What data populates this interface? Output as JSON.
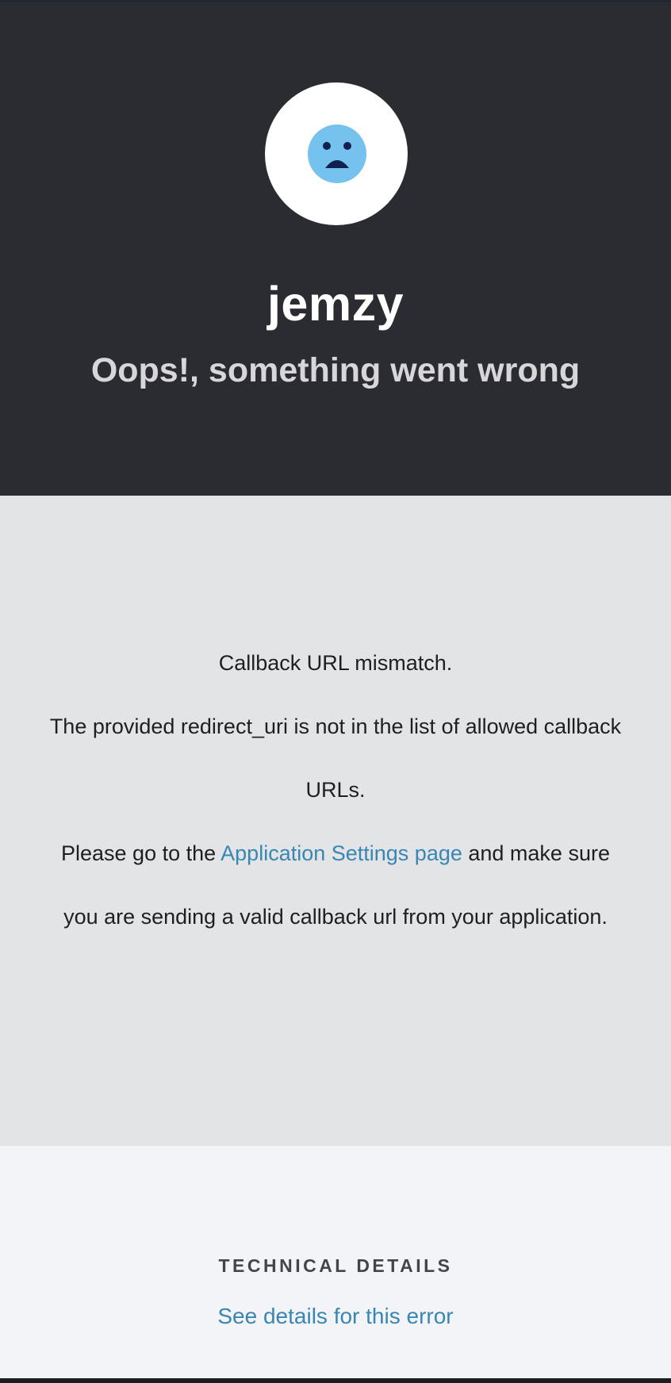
{
  "header": {
    "icon": "sad-face-icon",
    "app_name": "jemzy",
    "headline": "Oops!, something went wrong"
  },
  "message": {
    "line1": "Callback URL mismatch.",
    "line2": "The provided redirect_uri is not in the list of allowed callback URLs.",
    "line3_prefix": "Please go to the ",
    "line3_link": "Application Settings page",
    "line3_suffix": " and make sure you are sending a valid callback url from your application."
  },
  "technical_details": {
    "title": "TECHNICAL DETAILS",
    "link_label": "See details for this error"
  },
  "colors": {
    "header_bg": "#2b2c32",
    "message_bg": "#e3e4e6",
    "details_bg": "#f3f4f8",
    "link": "#3a86b3",
    "face": "#74c2ed",
    "face_features": "#122050"
  }
}
